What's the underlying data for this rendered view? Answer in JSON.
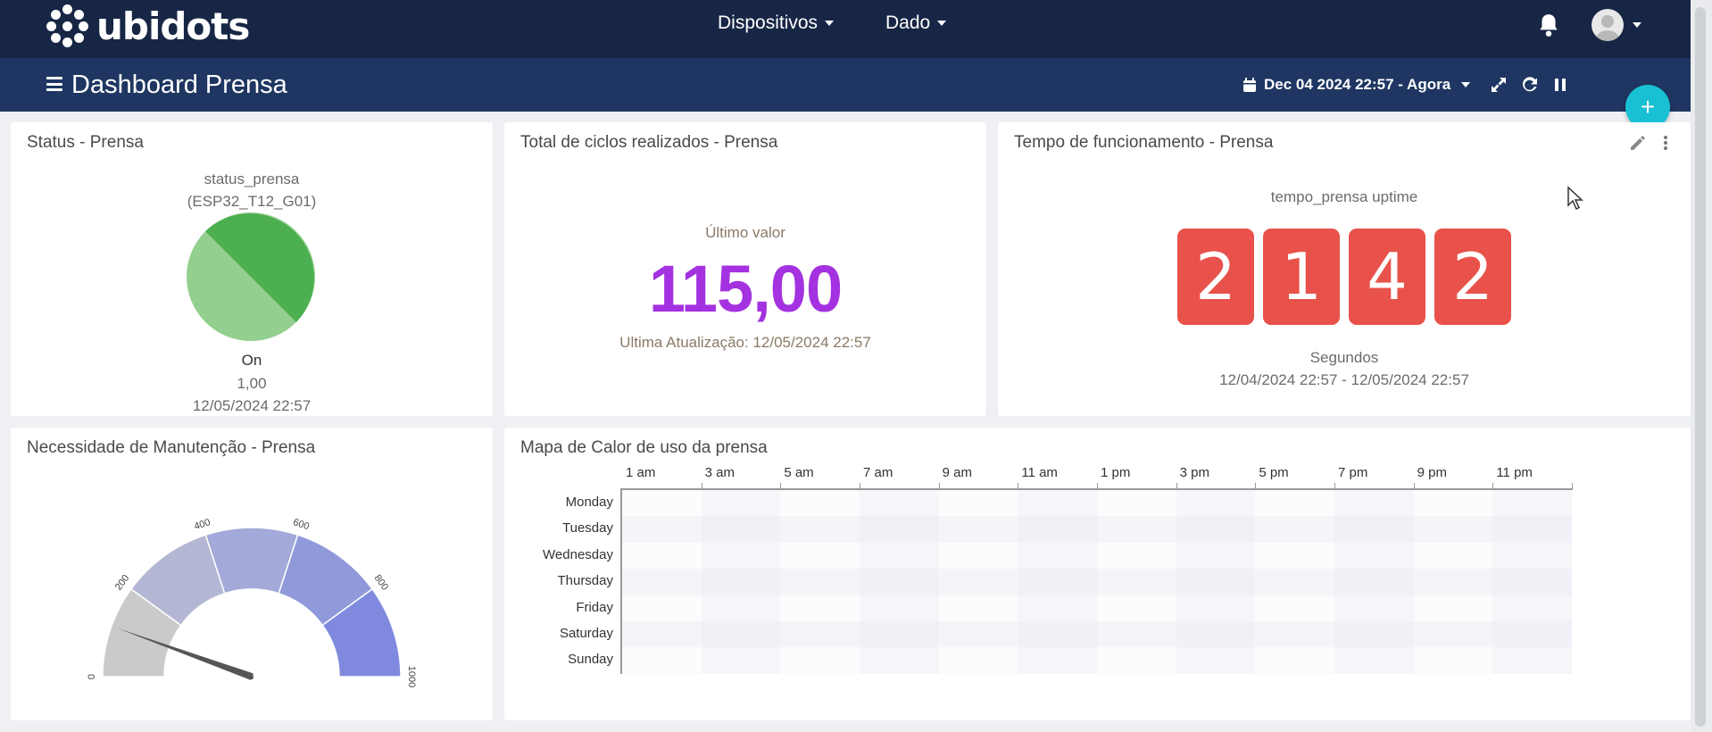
{
  "brand": {
    "name": "ubidots"
  },
  "nav": {
    "devices_label": "Dispositivos",
    "data_label": "Dado"
  },
  "dashboard": {
    "title": "Dashboard Prensa",
    "date_range": "Dec 04 2024 22:57 - Agora",
    "add_label": "+"
  },
  "widgets": {
    "status": {
      "title": "Status - Prensa",
      "variable": "status_prensa",
      "device": "(ESP32_T12_G01)",
      "state": "On",
      "value": "1,00",
      "timestamp": "12/05/2024 22:57",
      "pie_colors": [
        "#4caf50",
        "#93cf8e"
      ]
    },
    "cycles": {
      "title": "Total de ciclos realizados - Prensa",
      "caption": "Último valor",
      "value": "115,00",
      "updated": "Ultima Atualização: 12/05/2024 22:57",
      "value_color": "#a432e0"
    },
    "uptime": {
      "title": "Tempo de funcionamento - Prensa",
      "label": "tempo_prensa uptime",
      "digits": [
        "2",
        "1",
        "4",
        "2"
      ],
      "unit": "Segundos",
      "range": "12/04/2024 22:57 - 12/05/2024 22:57",
      "digit_color": "#e8524a"
    },
    "maintenance": {
      "title": "Necessidade de Manutenção - Prensa",
      "gauge": {
        "min": 0,
        "max": 1000,
        "ticks": [
          "0",
          "200",
          "400",
          "600",
          "800",
          "1000"
        ],
        "value": 110
      }
    },
    "heatmap": {
      "title": "Mapa de Calor de uso da prensa",
      "hours": [
        "1 am",
        "3 am",
        "5 am",
        "7 am",
        "9 am",
        "11 am",
        "1 pm",
        "3 pm",
        "5 pm",
        "7 pm",
        "9 pm",
        "11 pm"
      ],
      "days": [
        "Monday",
        "Tuesday",
        "Wednesday",
        "Thursday",
        "Friday",
        "Saturday",
        "Sunday"
      ]
    }
  }
}
